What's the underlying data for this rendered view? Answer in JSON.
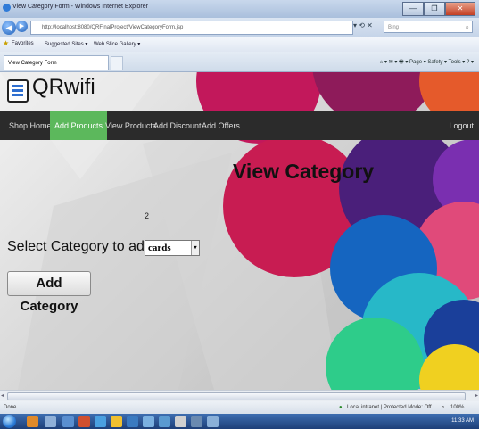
{
  "window": {
    "title": "View Category Form - Windows Internet Explorer",
    "controls": [
      "—",
      "❐",
      "✕"
    ]
  },
  "toolbar": {
    "back_glyph": "◀",
    "forward_glyph": "▶",
    "url": "http://localhost:8080/QRFinalProject/ViewCategoryForm.jsp",
    "addr_buttons": "▾ ⟲ ✕",
    "search_placeholder": "Bing",
    "search_glyph": "⌕"
  },
  "favorites": {
    "label": "Favorites",
    "items": [
      "Suggested Sites ▾",
      "Web Slice Gallery ▾"
    ]
  },
  "tab": {
    "label": "View Category Form"
  },
  "command_bar": "⌂ ▾  ✉ ▾  🖶 ▾  Page ▾  Safety ▾  Tools ▾  ? ▾",
  "brand": {
    "name": "QRwifi"
  },
  "nav": {
    "items": [
      "Shop Home",
      "Add Products",
      "View Products",
      "Add Discount",
      "Add Offers"
    ],
    "active_index": 1,
    "logout": "Logout"
  },
  "main": {
    "heading": "View Category",
    "count": "2",
    "select_label": "Select Category to add to:",
    "select_value": "cards",
    "add_button": "Add Category"
  },
  "status": {
    "left": "Done",
    "zone": "Local intranet | Protected Mode: Off",
    "zoom": "100%"
  },
  "taskbar": {
    "clock": "11:33 AM"
  },
  "colors": {
    "nav_bg": "#2b2b2b",
    "nav_active": "#5cb85c",
    "taskbar": "#1d3f78"
  }
}
